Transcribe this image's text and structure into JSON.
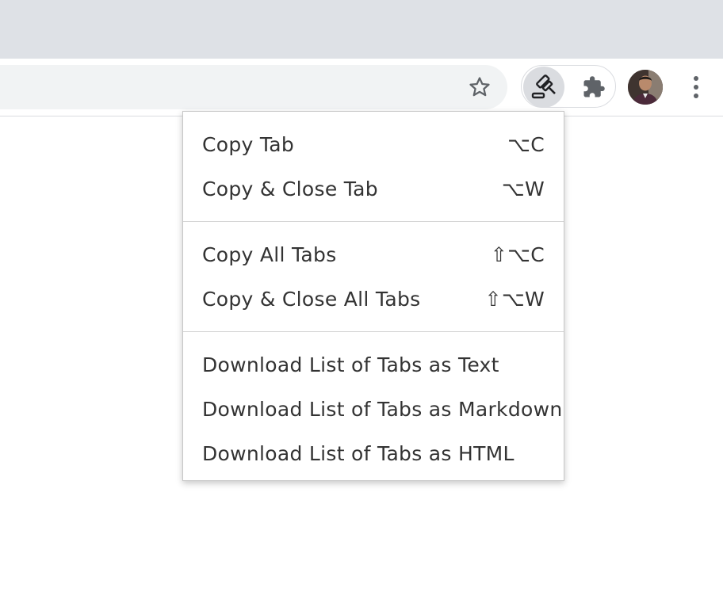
{
  "toolbar": {
    "star_icon": "star-outline-icon",
    "pinned_extension_icon": "gavel-icon",
    "extensions_icon": "puzzle-icon",
    "menu_icon": "vertical-dots-icon"
  },
  "menu": {
    "sections": [
      [
        {
          "label": "Copy Tab",
          "shortcut": "⌥C"
        },
        {
          "label": "Copy & Close Tab",
          "shortcut": "⌥W"
        }
      ],
      [
        {
          "label": "Copy All Tabs",
          "shortcut": "⇧⌥C"
        },
        {
          "label": "Copy & Close All Tabs",
          "shortcut": "⇧⌥W"
        }
      ],
      [
        {
          "label": "Download List of Tabs as Text",
          "shortcut": ""
        },
        {
          "label": "Download List of Tabs as Markdown",
          "shortcut": ""
        },
        {
          "label": "Download List of Tabs as HTML",
          "shortcut": ""
        }
      ]
    ]
  },
  "colors": {
    "tabstrip": "#dee1e6",
    "omnibox": "#f1f3f4",
    "icon": "#5f6368",
    "menu_text": "#333333"
  }
}
